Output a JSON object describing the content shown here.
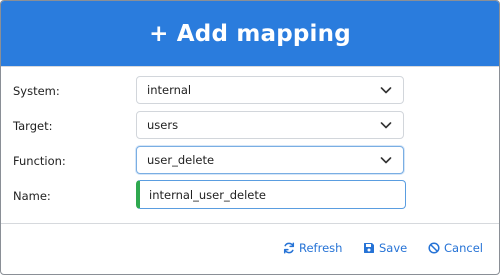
{
  "dialog": {
    "title": "+ Add mapping"
  },
  "form": {
    "system": {
      "label": "System:",
      "value": "internal"
    },
    "target": {
      "label": "Target:",
      "value": "users"
    },
    "function": {
      "label": "Function:",
      "value": "user_delete"
    },
    "name": {
      "label": "Name:",
      "value": "internal_user_delete"
    }
  },
  "footer": {
    "refresh_label": "Refresh",
    "save_label": "Save",
    "cancel_label": "Cancel"
  },
  "colors": {
    "header_bg": "#2a7cdd",
    "accent": "#2673d6",
    "valid_indicator": "#2fa84f"
  },
  "icons": {
    "refresh": "refresh-icon",
    "save": "save-icon",
    "cancel": "cancel-icon",
    "dropdown": "chevron-down-icon"
  }
}
